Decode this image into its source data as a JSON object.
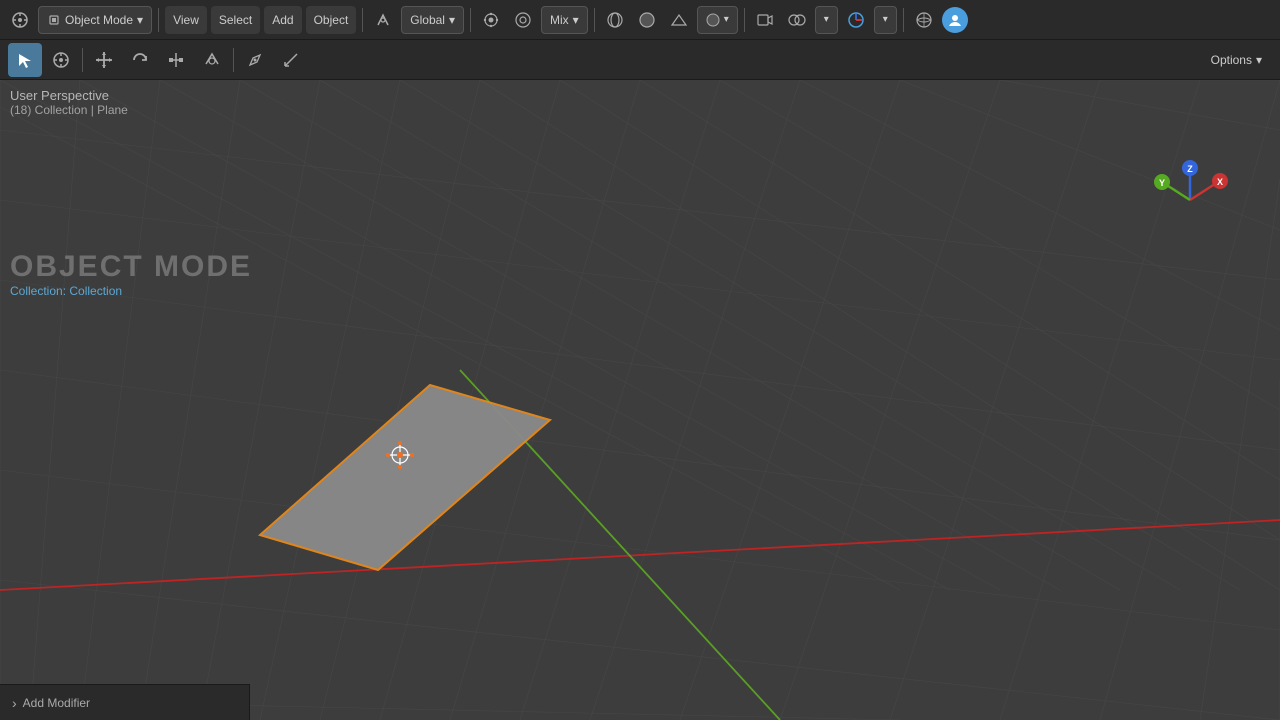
{
  "toolbar": {
    "mode_label": "Object Mode",
    "mode_chevron": "▾",
    "view_label": "View",
    "select_label": "Select",
    "add_label": "Add",
    "object_label": "Object",
    "transform_label": "Global",
    "transform_chevron": "▾",
    "snap_label": "Mix",
    "snap_chevron": "▾",
    "options_label": "Options",
    "options_chevron": "▾"
  },
  "viewport": {
    "perspective_label": "User Perspective",
    "collection_label": "(18) Collection | Plane",
    "mode_title": "OBJECT MODE",
    "collection_prefix": "Collection:",
    "collection_name": "Collection"
  },
  "axis": {
    "x_label": "X",
    "y_label": "Y",
    "z_label": "Z",
    "x_color": "#cc3333",
    "y_color": "#6faa30",
    "z_color": "#3366cc"
  },
  "bottom_panel": {
    "expand_icon": "›",
    "modifier_label": "Add Modifier"
  }
}
